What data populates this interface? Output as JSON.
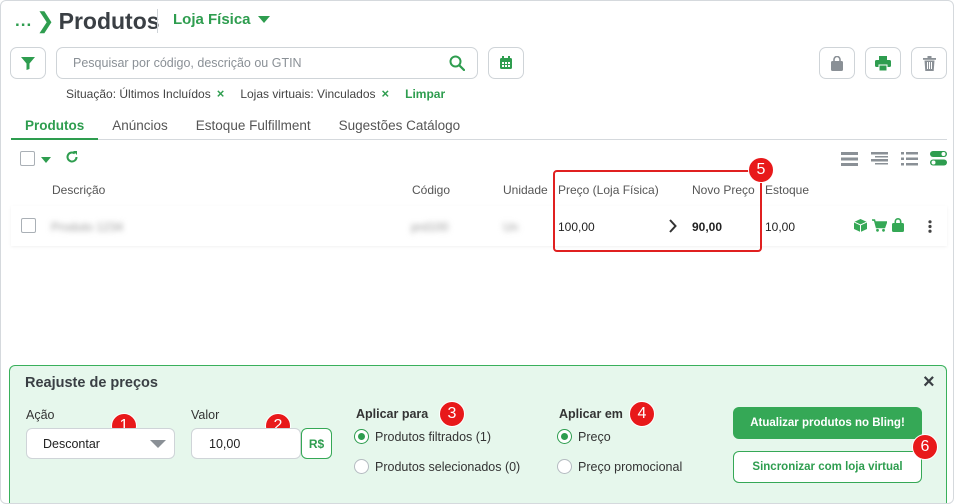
{
  "header": {
    "breadcrumb_dots": "...",
    "title": "Produtos",
    "store_selector": "Loja Física"
  },
  "search": {
    "placeholder": "Pesquisar por código, descrição ou GTIN"
  },
  "filters": {
    "chips": [
      {
        "label": "Situação: Últimos Incluídos",
        "remove": "×"
      },
      {
        "label": "Lojas virtuais: Vinculados",
        "remove": "×"
      }
    ],
    "clear_label": "Limpar"
  },
  "tabs": [
    {
      "label": "Produtos",
      "active": true
    },
    {
      "label": "Anúncios",
      "active": false
    },
    {
      "label": "Estoque Fulfillment",
      "active": false
    },
    {
      "label": "Sugestões Catálogo",
      "active": false
    }
  ],
  "table": {
    "columns": {
      "description": "Descrição",
      "code": "Código",
      "unit": "Unidade",
      "price": "Preço (Loja Física)",
      "new_price": "Novo Preço",
      "stock": "Estoque"
    },
    "rows": [
      {
        "description": "Produto 1234",
        "code": "prd100",
        "unit": "Un",
        "price": "100,00",
        "new_price": "90,00",
        "stock": "10,00"
      }
    ]
  },
  "adjust_panel": {
    "title": "Reajuste de preços",
    "action_label": "Ação",
    "action_value": "Descontar",
    "value_label": "Valor",
    "value": "10,00",
    "currency_toggle": "R$",
    "apply_to_label": "Aplicar para",
    "apply_to_options": [
      {
        "label": "Produtos filtrados (1)",
        "selected": true
      },
      {
        "label": "Produtos selecionados (0)",
        "selected": false
      }
    ],
    "apply_in_label": "Aplicar em",
    "apply_in_options": [
      {
        "label": "Preço",
        "selected": true
      },
      {
        "label": "Preço promocional",
        "selected": false
      }
    ],
    "primary_button": "Atualizar produtos no Bling!",
    "secondary_button": "Sincronizar com loja virtual",
    "close": "×"
  },
  "callouts": [
    "1",
    "2",
    "3",
    "4",
    "5",
    "6"
  ],
  "colors": {
    "brand_green": "#2e9d4f",
    "panel_bg": "#e6f7ec",
    "callout_red": "#e8191a"
  }
}
